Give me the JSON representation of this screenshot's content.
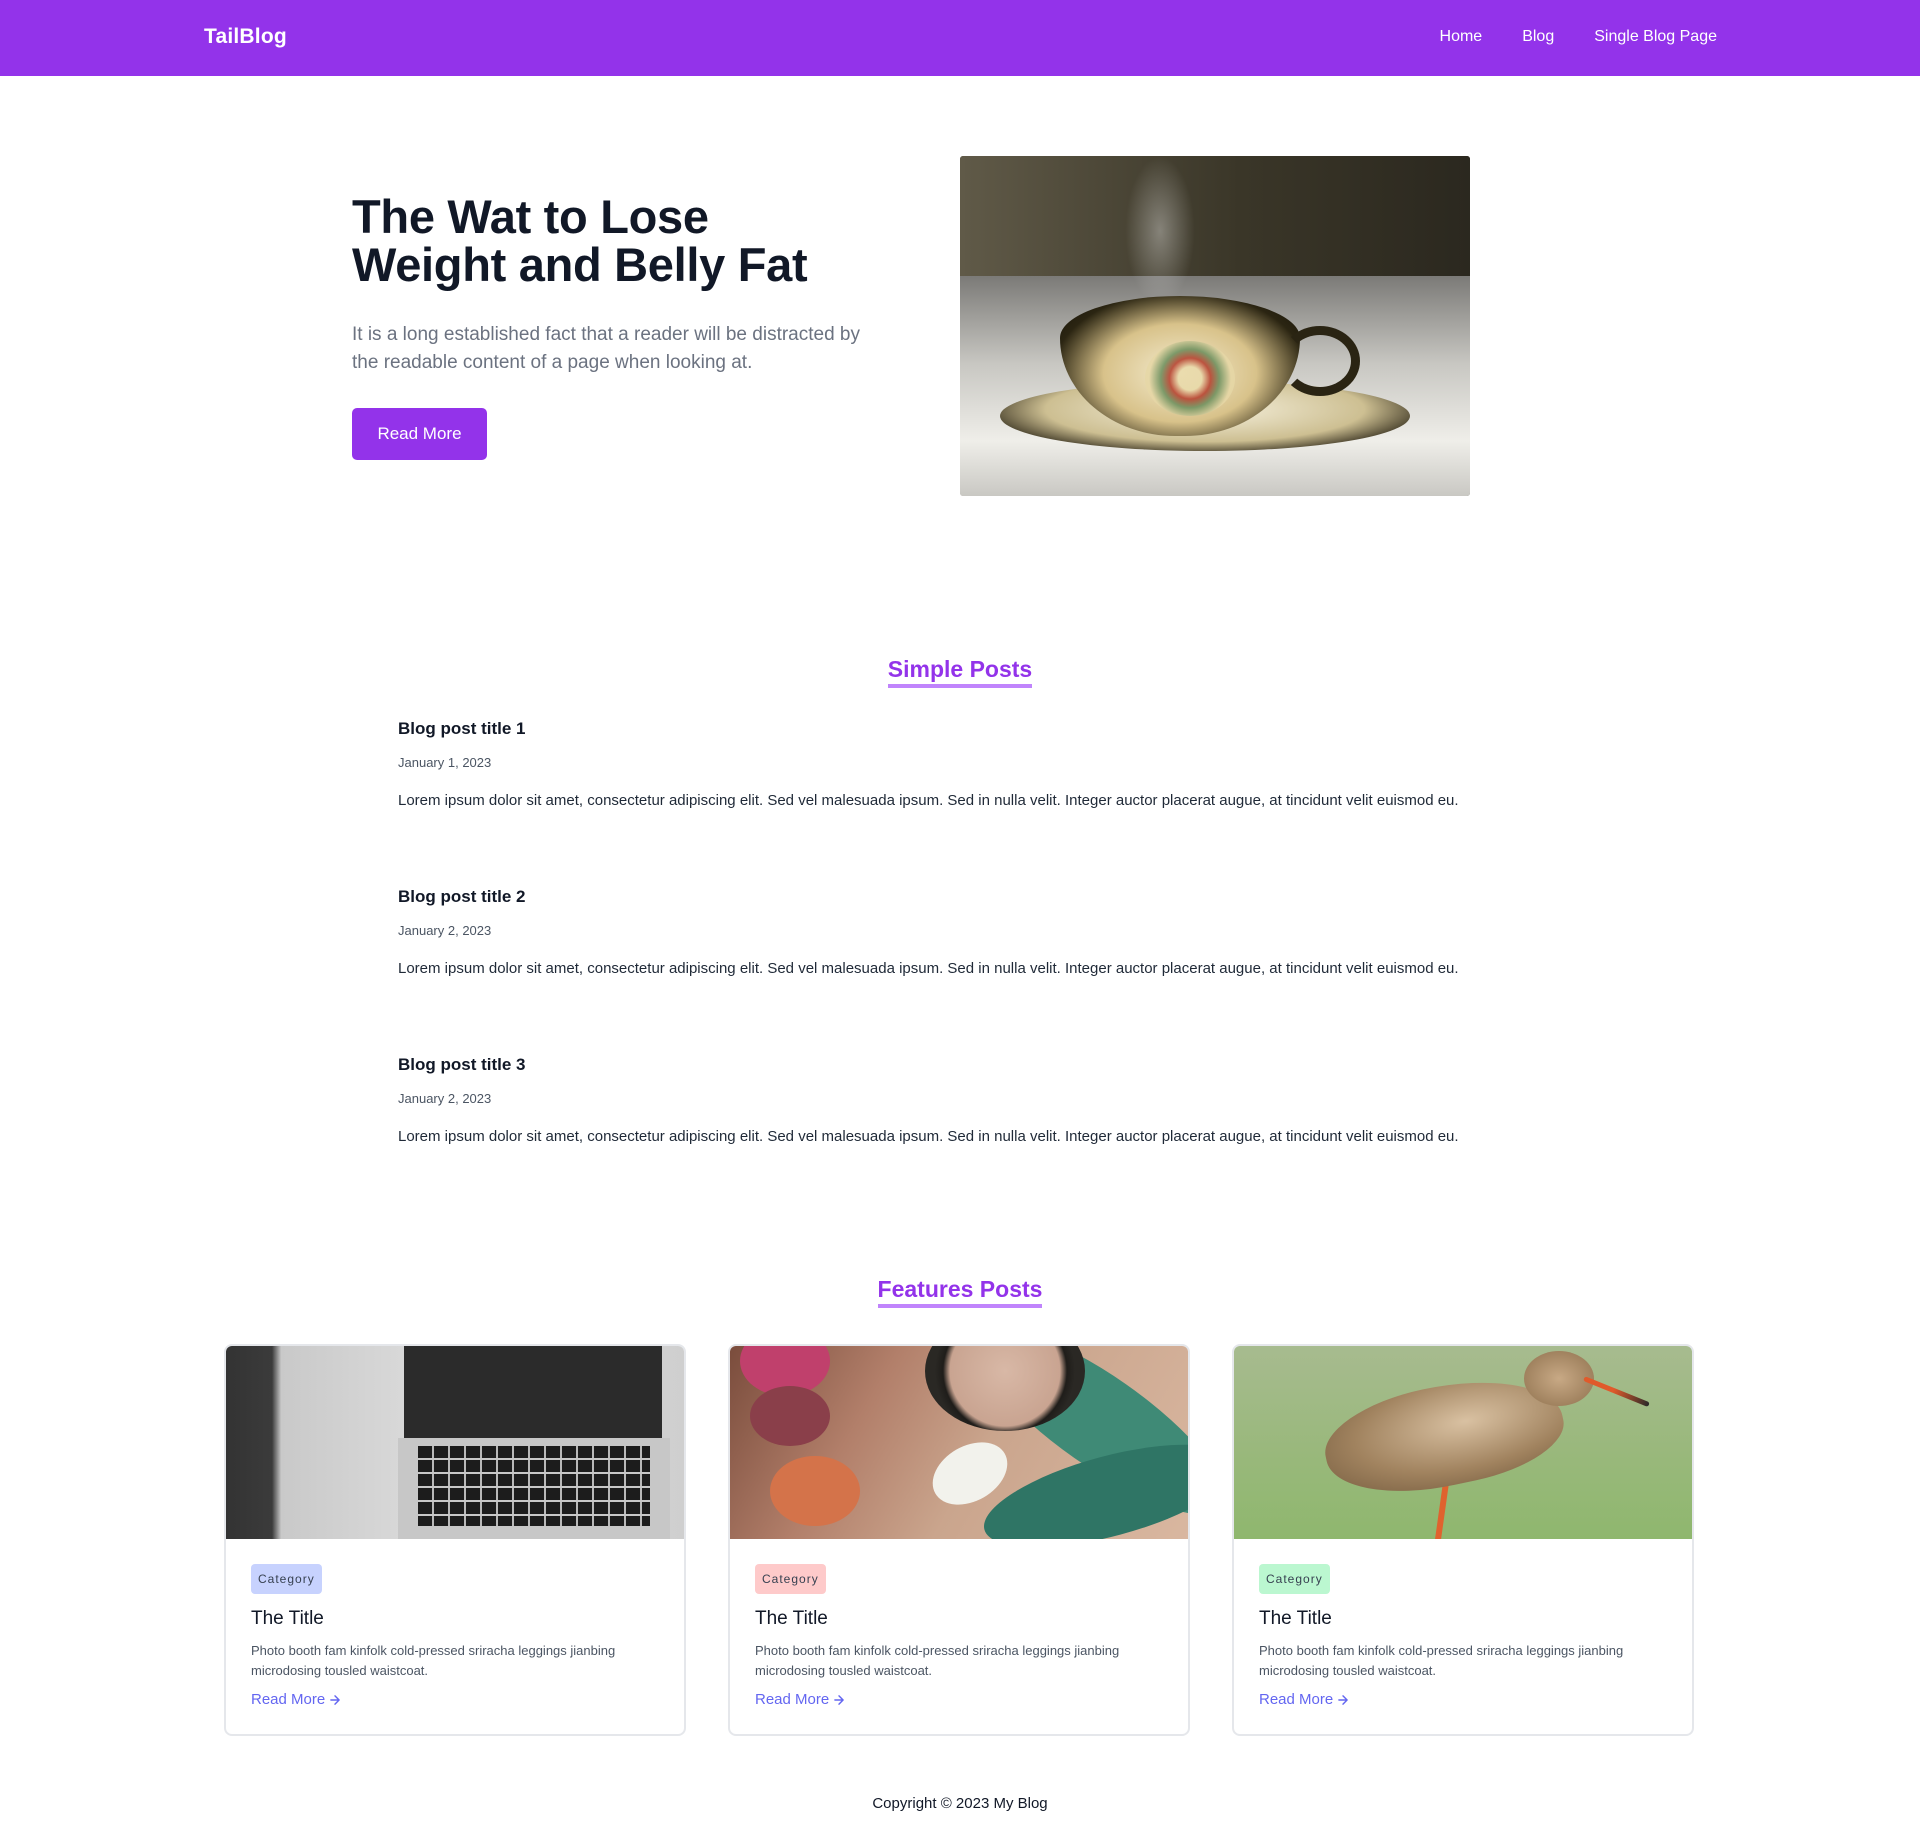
{
  "nav": {
    "brand": "TailBlog",
    "links": [
      "Home",
      "Blog",
      "Single Blog Page"
    ]
  },
  "hero": {
    "title": "The Wat to Lose Weight and Belly Fat",
    "description": "It is a long established fact that a reader will be distracted by the readable content of a page when looking at.",
    "button_label": "Read More"
  },
  "simple_posts": {
    "heading": "Simple Posts",
    "posts": [
      {
        "title": "Blog post title 1",
        "date": "January 1, 2023",
        "body": "Lorem ipsum dolor sit amet, consectetur adipiscing elit. Sed vel malesuada ipsum. Sed in nulla velit. Integer auctor placerat augue, at tincidunt velit euismod eu."
      },
      {
        "title": "Blog post title 2",
        "date": "January 2, 2023",
        "body": "Lorem ipsum dolor sit amet, consectetur adipiscing elit. Sed vel malesuada ipsum. Sed in nulla velit. Integer auctor placerat augue, at tincidunt velit euismod eu."
      },
      {
        "title": "Blog post title 3",
        "date": "January 2, 2023",
        "body": "Lorem ipsum dolor sit amet, consectetur adipiscing elit. Sed vel malesuada ipsum. Sed in nulla velit. Integer auctor placerat augue, at tincidunt velit euismod eu."
      }
    ]
  },
  "features": {
    "heading": "Features Posts",
    "cards": [
      {
        "category": "Category",
        "category_color": "#c7d2fe",
        "title": "The Title",
        "description": "Photo booth fam kinfolk cold-pressed sriracha leggings jianbing microdosing tousled waistcoat.",
        "link": "Read More",
        "image": "laptop-keyboard-photo"
      },
      {
        "category": "Category",
        "category_color": "#fecaca",
        "title": "The Title",
        "description": "Photo booth fam kinfolk cold-pressed sriracha leggings jianbing microdosing tousled waistcoat.",
        "link": "Read More",
        "image": "macarons-tulips-photo"
      },
      {
        "category": "Category",
        "category_color": "#bbf7d0",
        "title": "The Title",
        "description": "Photo booth fam kinfolk cold-pressed sriracha leggings jianbing microdosing tousled waistcoat.",
        "link": "Read More",
        "image": "sandpiper-bird-photo"
      }
    ]
  },
  "footer": {
    "text": "Copyright © 2023 My Blog"
  },
  "colors": {
    "brand_purple": "#9333ea",
    "heading_underline": "#c084fc",
    "link_indigo": "#6366f1"
  }
}
